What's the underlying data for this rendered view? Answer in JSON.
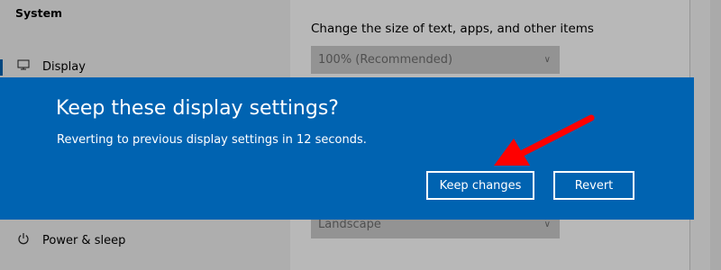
{
  "sidebar": {
    "title": "System",
    "items": [
      {
        "label": "Display",
        "icon": "monitor-icon"
      },
      {
        "label": "Power & sleep",
        "icon": "power-icon"
      }
    ]
  },
  "content": {
    "scale_label": "Change the size of text, apps, and other items",
    "scale_value": "100% (Recommended)",
    "orientation_value": "Landscape"
  },
  "dialog": {
    "title": "Keep these display settings?",
    "message": "Reverting to previous display settings in 12 seconds.",
    "keep_label": "Keep changes",
    "revert_label": "Revert"
  },
  "colors": {
    "dialog_bg": "#0063b1",
    "annotation_arrow": "#ff0000"
  }
}
